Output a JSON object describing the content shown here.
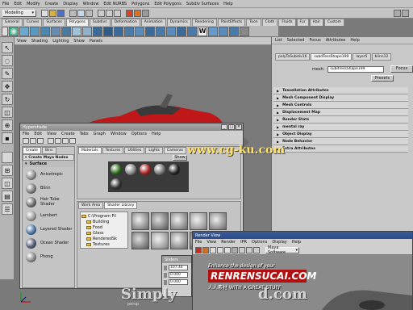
{
  "menubar": {
    "mode": "Modeling",
    "items": [
      "File",
      "Edit",
      "Modify",
      "Create",
      "Display",
      "Window",
      "Edit NURBS",
      "Polygons",
      "Edit Polygons",
      "Subdiv Surfaces",
      "Help"
    ]
  },
  "shelf": {
    "tabs": [
      "General",
      "Curves",
      "Surfaces",
      "Polygons",
      "Subdivs",
      "Deformation",
      "Animation",
      "Dynamics",
      "Rendering",
      "PaintEffects",
      "Toon",
      "Cloth",
      "Fluids",
      "Fur",
      "Hair",
      "Custom"
    ],
    "active_tab": 3,
    "icon_text": "W"
  },
  "viewport": {
    "menu": [
      "View",
      "Shading",
      "Lighting",
      "Show",
      "Panels"
    ],
    "colors": {
      "car": "#c01818",
      "ground": "#8a8a8a"
    },
    "corner_label": "persp"
  },
  "attr_editor": {
    "menu": [
      "List",
      "Selected",
      "Focus",
      "Attributes",
      "Help"
    ],
    "tabs": [
      "polyToSubdiv16",
      "subdTessShape199",
      "layer5",
      "blinn12"
    ],
    "active_tab": 1,
    "mesh_label": "mesh:",
    "mesh_value": "subdTessShape199",
    "focus_label": "Focus",
    "presets_label": "Presets",
    "sections": [
      "Tessellation Attributes",
      "Mesh Component Display",
      "Mesh Controls",
      "Displacement Map",
      "Render Stats",
      "mental ray",
      "Object Display",
      "Node Behavior",
      "Extra Attributes"
    ]
  },
  "hypershade": {
    "title": "Hypershade",
    "menu": [
      "File",
      "Edit",
      "View",
      "Create",
      "Tabs",
      "Graph",
      "Window",
      "Options",
      "Help"
    ],
    "left_tabs": [
      "Create",
      "Bins"
    ],
    "create_header": "Create Maya Nodes",
    "category": "Surface",
    "nodes": [
      "Anisotropic",
      "Blinn",
      "Hair Tube Shader",
      "Lambert",
      "Layered Shader",
      "Ocean Shader",
      "Phong"
    ],
    "node_colors": [
      "#8a8a8a",
      "#7a7a7a",
      "#6a6a6a",
      "#9a9a9a",
      "#4a70a0",
      "#505a70",
      "#888888"
    ],
    "top_tabs": [
      "Materials",
      "Textures",
      "Utilities",
      "Lights",
      "Cameras"
    ],
    "show_label": "Show",
    "swatch_colors": [
      "#2a6a1a",
      "#888888",
      "#aa2222",
      "#777777",
      "#222222",
      "#333333"
    ],
    "bottom_tabs": [
      "Work Area",
      "Shader Library"
    ],
    "folders": [
      "C:\\Program Fil",
      "Building",
      "Food",
      "Glass",
      "RenderedSk",
      "Textures"
    ]
  },
  "sliders": {
    "title": "Sliders",
    "fields": [
      "107.44",
      "0.000",
      "0.000"
    ]
  },
  "render_view": {
    "title": "Render View",
    "menu": [
      "File",
      "View",
      "Render",
      "IPR",
      "Options",
      "Display",
      "Help"
    ],
    "renderer": "Maya Software"
  },
  "watermark": {
    "url": "www.cg-ku.com",
    "bottom_left": "Simply",
    "bottom_mid": "d.com",
    "badge_line1": "Enhance the design of your",
    "badge_main": "RENRENSUCAI.COM",
    "badge_line3": "人人素材 WITH A GREAT STUFF"
  }
}
